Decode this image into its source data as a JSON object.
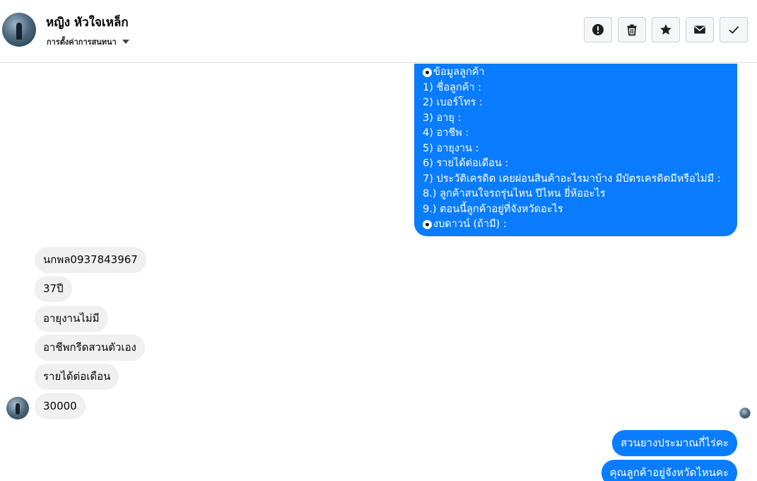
{
  "header": {
    "contact_name": "หญิง หัวใจเหล็ก",
    "conversation_settings": "การตั้งค่าการสนทนา",
    "toolbar": [
      {
        "name": "report-button",
        "icon": "exclamation-circle-icon"
      },
      {
        "name": "delete-button",
        "icon": "trash-icon"
      },
      {
        "name": "star-button",
        "icon": "star-icon"
      },
      {
        "name": "mark-unread-button",
        "icon": "envelope-icon"
      },
      {
        "name": "mark-done-button",
        "icon": "checkmark-icon"
      }
    ]
  },
  "messages": {
    "customer_form": {
      "lines": [
        "ข้อมูลลูกค้า",
        "1) ชื่อลูกค้า :",
        "2) เบอร์โทร :",
        "3) อายุ :",
        "4) อาชีพ :",
        "5) อายุงาน :",
        "6) รายได้ต่อเดือน :",
        "7) ประวัติเครดิต  เคยผ่อนสินค้าอะไรมาบ้าง มีบัตรเครดิตมีหรือไม่มี :",
        "8.) ลูกค้าสนใจรถรุ่นไหน ปีไหน ยี่ห้ออะไร",
        "9.) ตอนนี้ลูกค้าอยู่ที่จังหวัดอะไร",
        "งบดาวน์ (ถ้ามี) :"
      ]
    },
    "incoming": [
      "นกพล0937843967",
      "37ปี",
      "อายุงานไม่มี",
      "อาชีพกรีดสวนตัวเอง",
      "รายได้ต่อเดือน",
      "30000"
    ],
    "outgoing": [
      "สวนยางประมาณกี่ไร่คะ",
      "คุณลูกค้าอยู่จังหวัดไหนคะ"
    ]
  },
  "colors": {
    "outgoing_bubble": "#0a7cff",
    "incoming_bubble": "#f0f0f0"
  }
}
